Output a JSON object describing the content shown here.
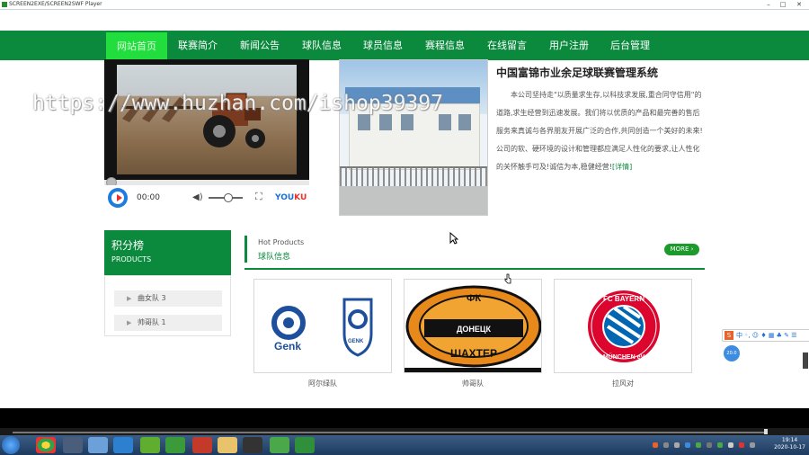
{
  "window": {
    "title": "SCREEN2EXE/SCREEN2SWF Player",
    "controls": [
      "–",
      "□",
      "✕"
    ]
  },
  "nav": {
    "items": [
      {
        "label": "网站首页",
        "active": true
      },
      {
        "label": "联赛简介"
      },
      {
        "label": "新闻公告"
      },
      {
        "label": "球队信息"
      },
      {
        "label": "球员信息"
      },
      {
        "label": "赛程信息"
      },
      {
        "label": "在线留言"
      },
      {
        "label": "用户注册"
      },
      {
        "label": "后台管理"
      }
    ]
  },
  "video": {
    "time": "00:00",
    "brand_you": "YOU",
    "brand_ku": "KU",
    "volume_level": 0.5
  },
  "intro": {
    "title": "中国富锦市业余足球联赛管理系统",
    "body": "本公司坚持走\"以质量求生存,以科技求发展,重合同守信用\"的道路,求生经营到迅速发展。我们将以优质的产品和最完善的售后服务来真诚与各界朋友开展广泛的合作,共同创造一个美好的未来!公司的软、硬环境的设计和管理都应满足人性化的要求,让人性化的关怀触手可及!诚信为本,稳健经营!",
    "more": "[详情]"
  },
  "watermark": "https://www.huzhan.com/ishop39397",
  "ranking": {
    "title": "积分榜",
    "subtitle": "PRODUCTS",
    "items": [
      {
        "label": "曲女队 3"
      },
      {
        "label": "帅哥队 1"
      }
    ]
  },
  "hot": {
    "en": "Hot Products",
    "cn": "球队信息",
    "more": "MORE ›"
  },
  "cards": [
    {
      "label": "阿尔绿队",
      "logo": "genk-logos"
    },
    {
      "label": "帅哥队",
      "logo": "shakhtar-donetsk-logo"
    },
    {
      "label": "拉风对",
      "logo": "fc-bayern-munchen-logo"
    }
  ],
  "logo_text": {
    "genk": "Genk",
    "genk_small": "GENK",
    "shakhtar_top": "ФК",
    "shakhtar_mid": "ДОНЕЦК",
    "shakhtar_bottom": "ШАХТЕР",
    "bayern_top": "FC BAYERN",
    "bayern_bottom": "MÜNCHEN eV"
  },
  "ime": {
    "label": "中 ◦, ☺ ♦ ▦ ♣ ✎ ☰"
  },
  "ime_ball": "20.0",
  "clock": {
    "time": "19:14",
    "date": "2020-10-17"
  },
  "colors": {
    "brand_green": "#0b8a3e",
    "nav_active": "#22dd3e",
    "more_button": "#1c9a2b"
  }
}
